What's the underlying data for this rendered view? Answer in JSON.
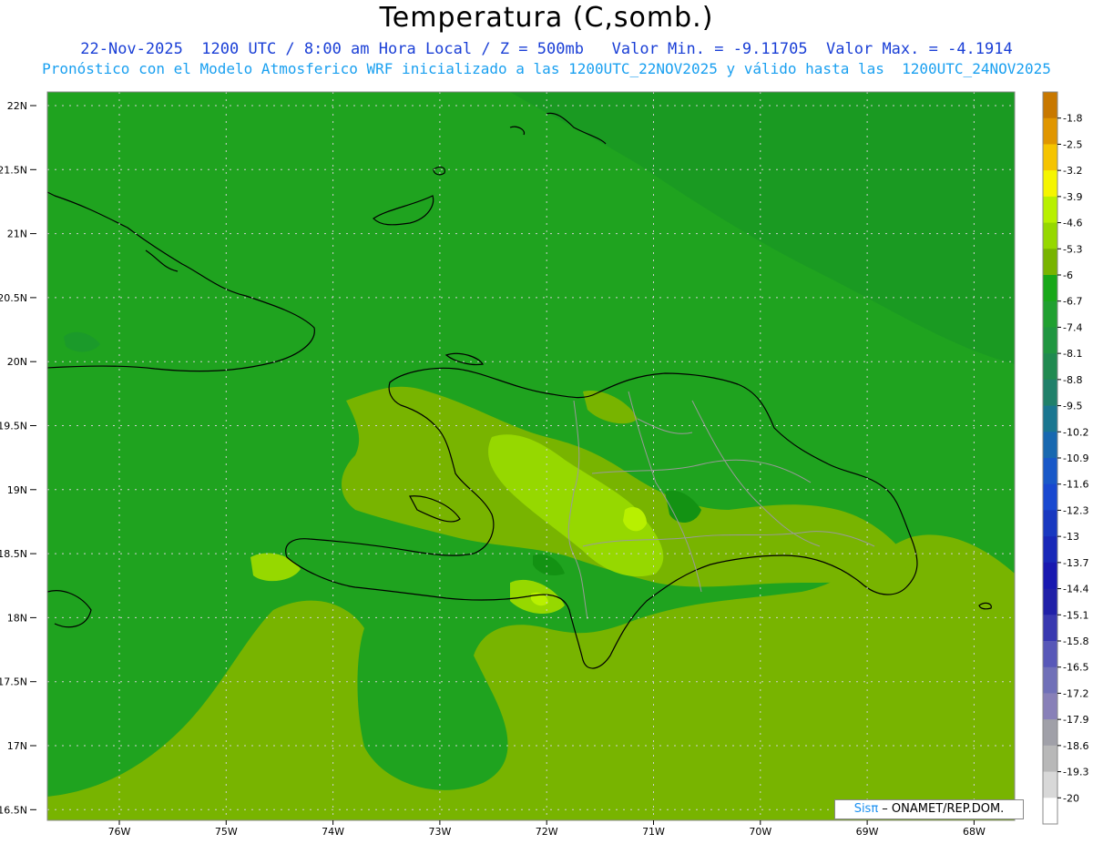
{
  "title": "Temperatura (C,somb.)",
  "subtitle1": "22-Nov-2025  1200 UTC / 8:00 am Hora Local / Z = 500mb   Valor Min. = -9.11705  Valor Max. = -4.1914",
  "subtitle2": "Pronóstico con el Modelo Atmosferico WRF inicializado a las 1200UTC_22NOV2025 y válido hasta las  1200UTC_24NOV2025",
  "credit": {
    "brand": "Sisπ",
    "dash": " – ",
    "org": "ONAMET/REP.DOM."
  },
  "lat_labels": [
    "22N",
    "21.5N",
    "21N",
    "20.5N",
    "20N",
    "19.5N",
    "19N",
    "18.5N",
    "18N",
    "17.5N",
    "17N",
    "16.5N"
  ],
  "lon_labels": [
    "76W",
    "75W",
    "74W",
    "73W",
    "72W",
    "71W",
    "70W",
    "69W",
    "68W"
  ],
  "colorbar_labels": [
    "-1.8",
    "-2.5",
    "-3.2",
    "-3.9",
    "-4.6",
    "-5.3",
    "-6",
    "-6.7",
    "-7.4",
    "-8.1",
    "-8.8",
    "-9.5",
    "-10.2",
    "-10.9",
    "-11.6",
    "-12.3",
    "-13",
    "-13.7",
    "-14.4",
    "-15.1",
    "-15.8",
    "-16.5",
    "-17.2",
    "-17.9",
    "-18.6",
    "-19.3",
    "-20"
  ],
  "colorbar_colors": [
    "#c87800",
    "#e09600",
    "#f5c400",
    "#f5f500",
    "#b8f000",
    "#96d800",
    "#78b400",
    "#18a818",
    "#20a030",
    "#209640",
    "#208a50",
    "#20806a",
    "#1a7690",
    "#1868b0",
    "#1858c8",
    "#1848d0",
    "#1838c0",
    "#1828b8",
    "#1818b0",
    "#2020a8",
    "#3838b0",
    "#5858b8",
    "#7070b8",
    "#8880b8",
    "#a0a0a8",
    "#b8b8b8",
    "#d8d8d8",
    "#ffffff"
  ],
  "colors": {
    "base_green": "#1fa31f",
    "olive": "#78b400",
    "light_green": "#96d800",
    "yellow_green": "#b8f000"
  }
}
